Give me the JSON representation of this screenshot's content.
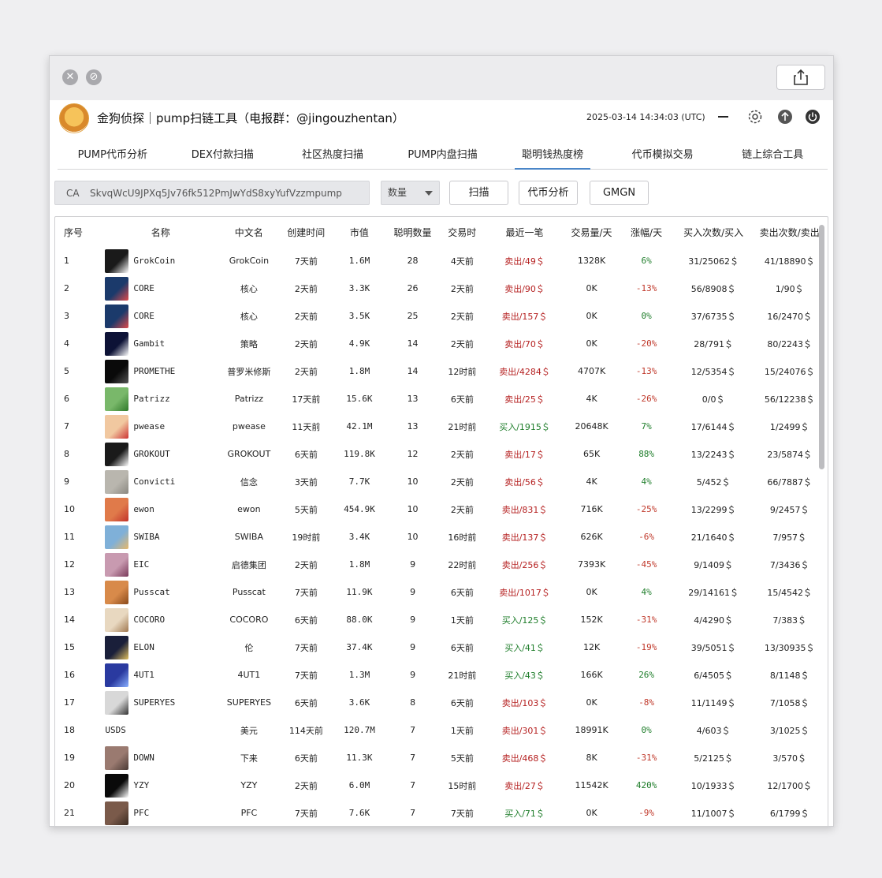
{
  "app": {
    "title": "金狗侦探｜pump扫链工具（电报群：@jingouzhentan）",
    "datetime": "2025-03-14 14:34:03 (UTC)"
  },
  "tabs": [
    "PUMP代币分析",
    "DEX付款扫描",
    "社区热度扫描",
    "PUMP内盘扫描",
    "聪明钱热度榜",
    "代币模拟交易",
    "链上综合工具"
  ],
  "active_tab": 4,
  "search": {
    "ca_label": "CA",
    "ca_value": "SkvqWcU9JPXq5Jv76fk512PmJwYdS8xyYufVzzmpump",
    "select_value": "数量",
    "scan_button": "扫描",
    "analyze_button": "代币分析",
    "gmgn_button": "GMGN"
  },
  "table": {
    "headers": [
      "序号",
      "名称",
      "中文名",
      "创建时间",
      "市值",
      "聪明数量",
      "交易时",
      "最近一笔",
      "交易量/天",
      "涨幅/天",
      "买入次数/买入",
      "卖出次数/卖出"
    ],
    "rows": [
      {
        "idx": "1",
        "name": "GrokCoin",
        "cname": "GrokCoin",
        "created": "7天前",
        "mcap": "1.6M",
        "smart": "28",
        "trade": "4天前",
        "last": "卖出/49＄",
        "last_type": "sell",
        "vol": "1328K",
        "chg": "6%",
        "chg_type": "up",
        "buy": "31/25062＄",
        "sell": "41/18890＄",
        "avatar": "#1a1a1a",
        "avatar2": "#ffffff"
      },
      {
        "idx": "2",
        "name": "CORE",
        "cname": "核心",
        "created": "2天前",
        "mcap": "3.3K",
        "smart": "26",
        "trade": "2天前",
        "last": "卖出/90＄",
        "last_type": "sell",
        "vol": "0K",
        "chg": "-13%",
        "chg_type": "down",
        "buy": "56/8908＄",
        "sell": "1/90＄",
        "avatar": "#1b3a6b",
        "avatar2": "#e04a4a"
      },
      {
        "idx": "3",
        "name": "CORE",
        "cname": "核心",
        "created": "2天前",
        "mcap": "3.5K",
        "smart": "25",
        "trade": "2天前",
        "last": "卖出/157＄",
        "last_type": "sell",
        "vol": "0K",
        "chg": "0%",
        "chg_type": "up",
        "buy": "37/6735＄",
        "sell": "16/2470＄",
        "avatar": "#1b3a6b",
        "avatar2": "#e04a4a"
      },
      {
        "idx": "4",
        "name": "Gambit",
        "cname": "策略",
        "created": "2天前",
        "mcap": "4.9K",
        "smart": "14",
        "trade": "2天前",
        "last": "卖出/70＄",
        "last_type": "sell",
        "vol": "0K",
        "chg": "-20%",
        "chg_type": "down",
        "buy": "28/791＄",
        "sell": "80/2243＄",
        "avatar": "#0d1236",
        "avatar2": "#ffffff"
      },
      {
        "idx": "5",
        "name": "PROMETHE",
        "cname": "普罗米修斯",
        "created": "2天前",
        "mcap": "1.8M",
        "smart": "14",
        "trade": "12时前",
        "last": "卖出/4284＄",
        "last_type": "sell",
        "vol": "4707K",
        "chg": "-13%",
        "chg_type": "down",
        "buy": "12/5354＄",
        "sell": "15/24076＄",
        "avatar": "#0a0a0a",
        "avatar2": "#555555"
      },
      {
        "idx": "6",
        "name": "Patrizz",
        "cname": "Patrizz",
        "created": "17天前",
        "mcap": "15.6K",
        "smart": "13",
        "trade": "6天前",
        "last": "卖出/25＄",
        "last_type": "sell",
        "vol": "4K",
        "chg": "-26%",
        "chg_type": "down",
        "buy": "0/0＄",
        "sell": "56/12238＄",
        "avatar": "#79b86a",
        "avatar2": "#2f7a2a"
      },
      {
        "idx": "7",
        "name": "pwease",
        "cname": "pwease",
        "created": "11天前",
        "mcap": "42.1M",
        "smart": "13",
        "trade": "21时前",
        "last": "买入/1915＄",
        "last_type": "buy",
        "vol": "20648K",
        "chg": "7%",
        "chg_type": "up",
        "buy": "17/6144＄",
        "sell": "1/2499＄",
        "avatar": "#f1c8a0",
        "avatar2": "#c33"
      },
      {
        "idx": "8",
        "name": "GROKOUT",
        "cname": "GROKOUT",
        "created": "6天前",
        "mcap": "119.8K",
        "smart": "12",
        "trade": "2天前",
        "last": "卖出/17＄",
        "last_type": "sell",
        "vol": "65K",
        "chg": "88%",
        "chg_type": "up",
        "buy": "13/2243＄",
        "sell": "23/5874＄",
        "avatar": "#1a1a1a",
        "avatar2": "#ffffff"
      },
      {
        "idx": "9",
        "name": "Convicti",
        "cname": "信念",
        "created": "3天前",
        "mcap": "7.7K",
        "smart": "10",
        "trade": "2天前",
        "last": "卖出/56＄",
        "last_type": "sell",
        "vol": "4K",
        "chg": "4%",
        "chg_type": "up",
        "buy": "5/452＄",
        "sell": "66/7887＄",
        "avatar": "#b9b6ae",
        "avatar2": "#8a8780"
      },
      {
        "idx": "10",
        "name": "ewon",
        "cname": "ewon",
        "created": "5天前",
        "mcap": "454.9K",
        "smart": "10",
        "trade": "2天前",
        "last": "卖出/831＄",
        "last_type": "sell",
        "vol": "716K",
        "chg": "-25%",
        "chg_type": "down",
        "buy": "13/2299＄",
        "sell": "9/2457＄",
        "avatar": "#e07a4a",
        "avatar2": "#c2332a"
      },
      {
        "idx": "11",
        "name": "SWIBA",
        "cname": "SWIBA",
        "created": "19时前",
        "mcap": "3.4K",
        "smart": "10",
        "trade": "16时前",
        "last": "卖出/137＄",
        "last_type": "sell",
        "vol": "626K",
        "chg": "-6%",
        "chg_type": "down",
        "buy": "21/1640＄",
        "sell": "7/957＄",
        "avatar": "#7fb0d8",
        "avatar2": "#e8b86a"
      },
      {
        "idx": "12",
        "name": "EIC",
        "cname": "启德集团",
        "created": "2天前",
        "mcap": "1.8M",
        "smart": "9",
        "trade": "22时前",
        "last": "卖出/256＄",
        "last_type": "sell",
        "vol": "7393K",
        "chg": "-45%",
        "chg_type": "down",
        "buy": "9/1409＄",
        "sell": "7/3436＄",
        "avatar": "#c89ab0",
        "avatar2": "#7a3a5a"
      },
      {
        "idx": "13",
        "name": "Pusscat",
        "cname": "Pusscat",
        "created": "7天前",
        "mcap": "11.9K",
        "smart": "9",
        "trade": "6天前",
        "last": "卖出/1017＄",
        "last_type": "sell",
        "vol": "0K",
        "chg": "4%",
        "chg_type": "up",
        "buy": "29/14161＄",
        "sell": "15/4542＄",
        "avatar": "#d88a4a",
        "avatar2": "#8a4a1a"
      },
      {
        "idx": "14",
        "name": "COCORO",
        "cname": "COCORO",
        "created": "6天前",
        "mcap": "88.0K",
        "smart": "9",
        "trade": "1天前",
        "last": "买入/125＄",
        "last_type": "buy",
        "vol": "152K",
        "chg": "-31%",
        "chg_type": "down",
        "buy": "4/4290＄",
        "sell": "7/383＄",
        "avatar": "#e8d8c0",
        "avatar2": "#a07850"
      },
      {
        "idx": "15",
        "name": "ELON",
        "cname": "伦",
        "created": "7天前",
        "mcap": "37.4K",
        "smart": "9",
        "trade": "6天前",
        "last": "买入/41＄",
        "last_type": "buy",
        "vol": "12K",
        "chg": "-19%",
        "chg_type": "down",
        "buy": "39/5051＄",
        "sell": "13/30935＄",
        "avatar": "#1a1f3a",
        "avatar2": "#e0c060"
      },
      {
        "idx": "16",
        "name": "4UT1",
        "cname": "4UT1",
        "created": "7天前",
        "mcap": "1.3M",
        "smart": "9",
        "trade": "21时前",
        "last": "买入/43＄",
        "last_type": "buy",
        "vol": "166K",
        "chg": "26%",
        "chg_type": "up",
        "buy": "6/4505＄",
        "sell": "8/1148＄",
        "avatar": "#2a3aa0",
        "avatar2": "#8ab0ff"
      },
      {
        "idx": "17",
        "name": "SUPERYES",
        "cname": "SUPERYES",
        "created": "6天前",
        "mcap": "3.6K",
        "smart": "8",
        "trade": "6天前",
        "last": "卖出/103＄",
        "last_type": "sell",
        "vol": "0K",
        "chg": "-8%",
        "chg_type": "down",
        "buy": "11/1149＄",
        "sell": "7/1058＄",
        "avatar": "#d8d8d8",
        "avatar2": "#333333"
      },
      {
        "idx": "18",
        "name": "USDS",
        "cname": "美元",
        "created": "114天前",
        "mcap": "120.7M",
        "smart": "7",
        "trade": "1天前",
        "last": "卖出/301＄",
        "last_type": "sell",
        "vol": "18991K",
        "chg": "0%",
        "chg_type": "up",
        "buy": "4/603＄",
        "sell": "3/1025＄",
        "avatar": "",
        "avatar2": ""
      },
      {
        "idx": "19",
        "name": "DOWN",
        "cname": "下来",
        "created": "6天前",
        "mcap": "11.3K",
        "smart": "7",
        "trade": "5天前",
        "last": "卖出/468＄",
        "last_type": "sell",
        "vol": "8K",
        "chg": "-31%",
        "chg_type": "down",
        "buy": "5/2125＄",
        "sell": "3/570＄",
        "avatar": "#9a7a70",
        "avatar2": "#4a3a35"
      },
      {
        "idx": "20",
        "name": "YZY",
        "cname": "YZY",
        "created": "2天前",
        "mcap": "6.0M",
        "smart": "7",
        "trade": "15时前",
        "last": "卖出/27＄",
        "last_type": "sell",
        "vol": "11542K",
        "chg": "420%",
        "chg_type": "up",
        "buy": "10/1933＄",
        "sell": "12/1700＄",
        "avatar": "#0a0a0a",
        "avatar2": "#ffffff"
      },
      {
        "idx": "21",
        "name": "PFC",
        "cname": "PFC",
        "created": "7天前",
        "mcap": "7.6K",
        "smart": "7",
        "trade": "7天前",
        "last": "买入/71＄",
        "last_type": "buy",
        "vol": "0K",
        "chg": "-9%",
        "chg_type": "down",
        "buy": "11/1007＄",
        "sell": "6/1799＄",
        "avatar": "#7a5a4a",
        "avatar2": "#3a2a20"
      }
    ]
  }
}
